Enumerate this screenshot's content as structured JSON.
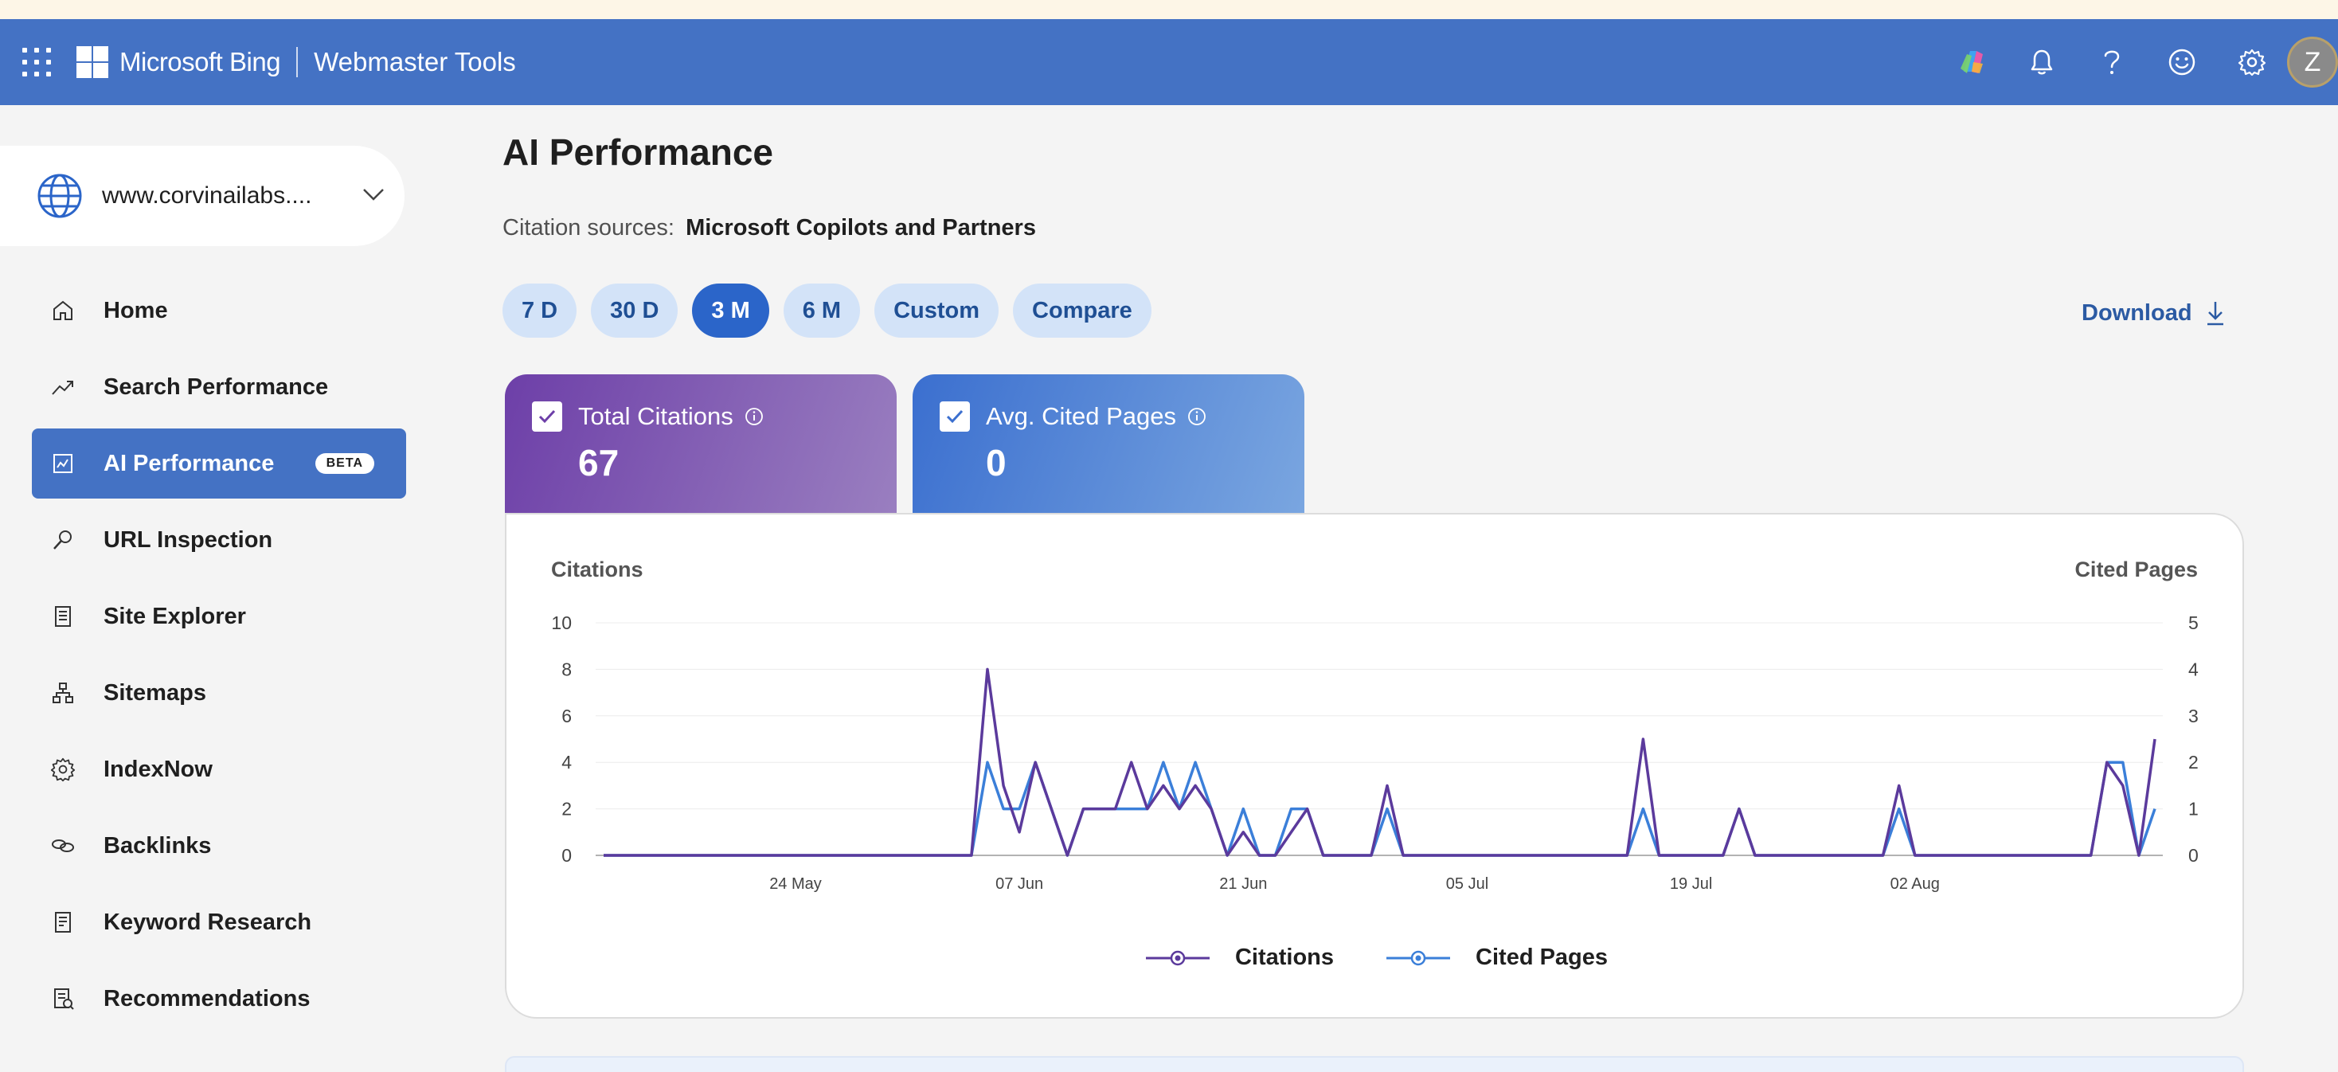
{
  "header": {
    "brand_name": "Microsoft Bing",
    "product_name": "Webmaster Tools",
    "avatar_initial": "Z",
    "bar_color": "#4472c4"
  },
  "site_picker": {
    "site": "www.corvinailabs...."
  },
  "nav": {
    "items": [
      {
        "label": "Home",
        "icon": "home-icon"
      },
      {
        "label": "Search Performance",
        "icon": "trend-icon"
      },
      {
        "label": "AI Performance",
        "icon": "ai-chart-icon",
        "badge": "BETA"
      },
      {
        "label": "URL Inspection",
        "icon": "magnifier-icon"
      },
      {
        "label": "Site Explorer",
        "icon": "document-list-icon"
      },
      {
        "label": "Sitemaps",
        "icon": "sitemap-icon"
      },
      {
        "label": "IndexNow",
        "icon": "gear-icon"
      },
      {
        "label": "Backlinks",
        "icon": "link-icon"
      },
      {
        "label": "Keyword Research",
        "icon": "document-icon"
      },
      {
        "label": "Recommendations",
        "icon": "recommendation-icon"
      }
    ]
  },
  "main": {
    "title": "AI Performance",
    "citation_label": "Citation sources:",
    "citation_value": "Microsoft Copilots and Partners",
    "ranges": [
      "7 D",
      "30 D",
      "3 M",
      "6 M",
      "Custom",
      "Compare"
    ],
    "active_range": "3 M",
    "download_label": "Download",
    "cards": {
      "citations": {
        "label": "Total Citations",
        "value": "67"
      },
      "pages": {
        "label": "Avg. Cited Pages",
        "value": "0"
      }
    },
    "chart_titles": {
      "left": "Citations",
      "right": "Cited Pages"
    },
    "legend": {
      "citations": "Citations",
      "pages": "Cited Pages"
    }
  },
  "chart_data": {
    "type": "line",
    "x_labels": [
      "24 May",
      "07 Jun",
      "21 Jun",
      "05 Jul",
      "19 Jul",
      "02 Aug"
    ],
    "y_left_ticks": [
      "0",
      "2",
      "4",
      "6",
      "8",
      "10"
    ],
    "y_right_ticks": [
      "0",
      "1",
      "2",
      "3",
      "4",
      "5"
    ],
    "ylim_left": [
      0,
      10
    ],
    "ylim_right": [
      0,
      5
    ],
    "series": [
      {
        "name": "Citations",
        "axis": "left",
        "color": "#5b3a9c",
        "values": [
          0,
          0,
          0,
          0,
          0,
          0,
          0,
          0,
          0,
          0,
          0,
          0,
          0,
          0,
          0,
          0,
          0,
          0,
          0,
          0,
          0,
          0,
          0,
          0,
          8,
          3,
          1,
          4,
          2,
          0,
          2,
          2,
          2,
          4,
          2,
          3,
          2,
          3,
          2,
          0,
          1,
          0,
          0,
          1,
          2,
          0,
          0,
          0,
          0,
          3,
          0,
          0,
          0,
          0,
          0,
          0,
          0,
          0,
          0,
          0,
          0,
          0,
          0,
          0,
          0,
          5,
          0,
          0,
          0,
          0,
          0,
          2,
          0,
          0,
          0,
          0,
          0,
          0,
          0,
          0,
          0,
          3,
          0,
          0,
          0,
          0,
          0,
          0,
          0,
          0,
          0,
          0,
          0,
          0,
          4,
          3,
          0,
          5
        ]
      },
      {
        "name": "Cited Pages",
        "axis": "right",
        "color": "#3b7fd9",
        "values": [
          0,
          0,
          0,
          0,
          0,
          0,
          0,
          0,
          0,
          0,
          0,
          0,
          0,
          0,
          0,
          0,
          0,
          0,
          0,
          0,
          0,
          0,
          0,
          0,
          2,
          1,
          1,
          2,
          1,
          0,
          1,
          1,
          1,
          1,
          1,
          2,
          1,
          2,
          1,
          0,
          1,
          0,
          0,
          1,
          1,
          0,
          0,
          0,
          0,
          1,
          0,
          0,
          0,
          0,
          0,
          0,
          0,
          0,
          0,
          0,
          0,
          0,
          0,
          0,
          0,
          1,
          0,
          0,
          0,
          0,
          0,
          1,
          0,
          0,
          0,
          0,
          0,
          0,
          0,
          0,
          0,
          1,
          0,
          0,
          0,
          0,
          0,
          0,
          0,
          0,
          0,
          0,
          0,
          0,
          2,
          2,
          0,
          1
        ]
      }
    ],
    "grid": true
  }
}
